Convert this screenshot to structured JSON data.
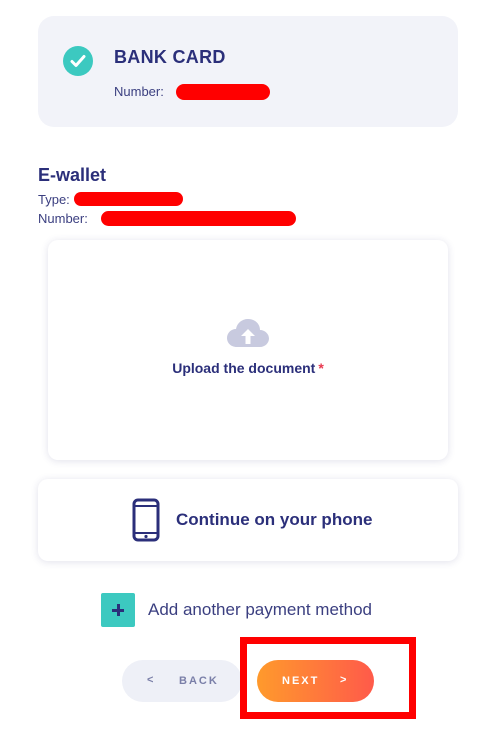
{
  "bank_card": {
    "title": "BANK CARD",
    "number_label": "Number:"
  },
  "ewallet": {
    "title": "E-wallet",
    "type_label": "Type:",
    "number_label": "Number:"
  },
  "upload": {
    "label": "Upload the document",
    "required_mark": "*"
  },
  "phone": {
    "label": "Continue on your phone"
  },
  "add_method": {
    "label": "Add another payment method"
  },
  "nav": {
    "back_chevron": "<",
    "back_label": "BACK",
    "next_label": "NEXT",
    "next_chevron": ">"
  },
  "colors": {
    "accent_teal": "#3cc9c0",
    "navy": "#2b2f7a",
    "next_gradient_start": "#ff9a2c",
    "next_gradient_end": "#ff5a4a",
    "redaction": "#ff0000"
  },
  "icons": {
    "bank_status": "check-circle-icon",
    "upload": "cloud-upload-icon",
    "phone": "smartphone-icon",
    "add": "plus-icon"
  }
}
